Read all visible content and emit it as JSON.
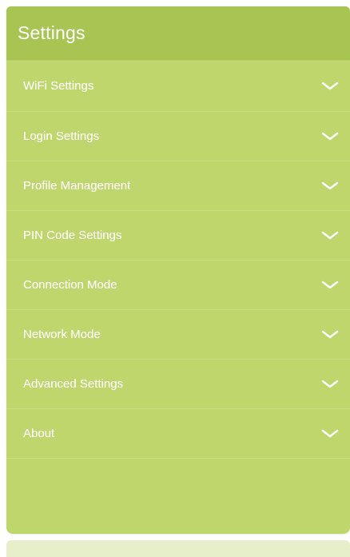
{
  "header": {
    "title": "Settings"
  },
  "menu": {
    "items": [
      {
        "label": "WiFi Settings",
        "icon": "chevron-down-icon"
      },
      {
        "label": "Login Settings",
        "icon": "chevron-down-icon"
      },
      {
        "label": "Profile Management",
        "icon": "chevron-down-icon"
      },
      {
        "label": "PIN Code Settings",
        "icon": "chevron-down-icon"
      },
      {
        "label": "Connection Mode",
        "icon": "chevron-down-icon"
      },
      {
        "label": "Network Mode",
        "icon": "chevron-down-icon"
      },
      {
        "label": "Advanced Settings",
        "icon": "chevron-down-icon"
      },
      {
        "label": "About",
        "icon": "chevron-down-icon"
      }
    ]
  },
  "colors": {
    "header_bg": "#a8c554",
    "panel_bg": "#bfd66d",
    "text": "#ffffff",
    "bottom_strip": "#e6efc9"
  }
}
